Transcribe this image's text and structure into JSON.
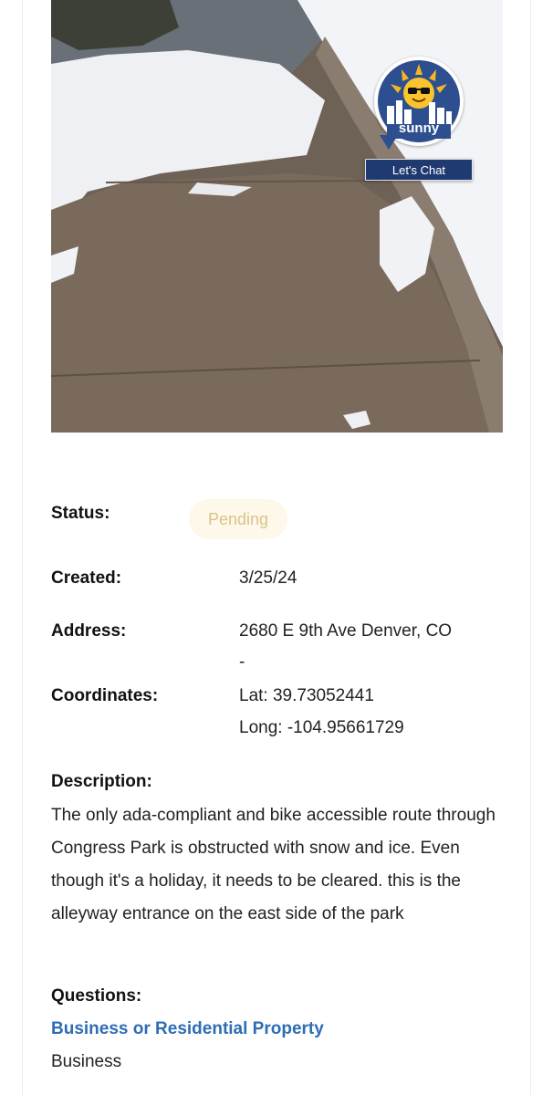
{
  "report": {
    "status_label": "Status:",
    "status_value": "Pending",
    "created_label": "Created:",
    "created_value": "3/25/24",
    "address_label": "Address:",
    "address_line1": "2680 E 9th Ave Denver, CO",
    "address_line2": "-",
    "coordinates_label": "Coordinates:",
    "lat": "Lat: 39.73052441",
    "long": "Long: -104.95661729",
    "description_label": "Description:",
    "description_text": "The only ada-compliant and bike accessible route through Congress Park is obstructed with snow and ice. Even though it's a holiday, it needs to be cleared. this is the alleyway entrance on the east side of the park",
    "questions_label": "Questions:",
    "question_1": "Business or Residential Property",
    "answer_1": "Business"
  },
  "chat_widget": {
    "brand": "sunny",
    "button_label": "Let's Chat"
  },
  "colors": {
    "link": "#2e6db4",
    "status_pending_bg": "#fdf8ea",
    "status_pending_text": "#d8c48a",
    "chat_button": "#1f3a70"
  }
}
